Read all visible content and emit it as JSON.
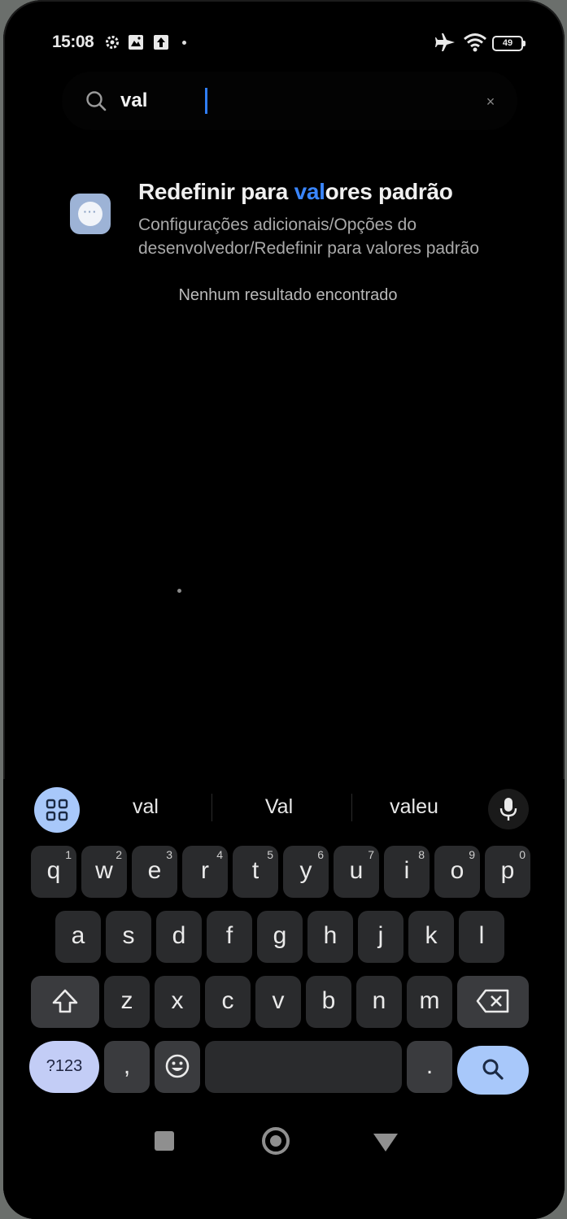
{
  "status_bar": {
    "time": "15:08",
    "battery": "49",
    "icons": [
      "settings-gear-icon",
      "gallery-icon",
      "upload-icon",
      "notification-dot-icon",
      "airplane-icon",
      "wifi-icon",
      "battery-icon"
    ]
  },
  "search": {
    "query": "val",
    "clear_symbol": "×"
  },
  "results": [
    {
      "title_prefix": "Redefinir para ",
      "title_highlight": "val",
      "title_suffix": "ores padrão",
      "path": "Configurações adicionais/Opções do desenvolvedor/Redefinir para valores padrão",
      "icon": "more-options-icon"
    }
  ],
  "no_results_text": "Nenhum resultado encontrado",
  "keyboard": {
    "suggestions": [
      "val",
      "Val",
      "valeu"
    ],
    "row1": [
      {
        "k": "q",
        "n": "1"
      },
      {
        "k": "w",
        "n": "2"
      },
      {
        "k": "e",
        "n": "3"
      },
      {
        "k": "r",
        "n": "4"
      },
      {
        "k": "t",
        "n": "5"
      },
      {
        "k": "y",
        "n": "6"
      },
      {
        "k": "u",
        "n": "7"
      },
      {
        "k": "i",
        "n": "8"
      },
      {
        "k": "o",
        "n": "9"
      },
      {
        "k": "p",
        "n": "0"
      }
    ],
    "row2": [
      "a",
      "s",
      "d",
      "f",
      "g",
      "h",
      "j",
      "k",
      "l"
    ],
    "row3": [
      "z",
      "x",
      "c",
      "v",
      "b",
      "n",
      "m"
    ],
    "symbols_label": "?123",
    "comma": ",",
    "period": "."
  },
  "colors": {
    "highlight": "#3a86ff",
    "accent_key": "#a8c8fa",
    "background": "#000000"
  }
}
